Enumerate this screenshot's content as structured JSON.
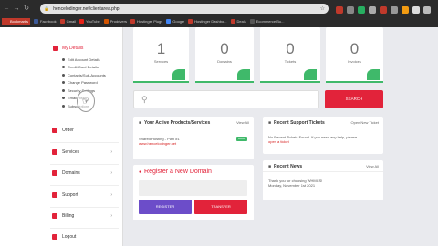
{
  "browser": {
    "url": "hencelodinger.net/clientarea.php",
    "bookmarks": [
      {
        "label": "Bookmarks",
        "color": "#c0392b"
      },
      {
        "label": "Facebook",
        "color": "#3b5998"
      },
      {
        "label": "Gmail",
        "color": "#c0392b"
      },
      {
        "label": "YouTube",
        "color": "#e62117"
      },
      {
        "label": "Prodrivers",
        "color": "#d35400"
      },
      {
        "label": "Hostinger Plugs",
        "color": "#c0392b"
      },
      {
        "label": "Google",
        "color": "#4285f4"
      },
      {
        "label": "Hostinger Dashbo...",
        "color": "#c0392b"
      },
      {
        "label": "Deals",
        "color": "#c0392b"
      },
      {
        "label": "Ecommerce Bu...",
        "color": "#555"
      }
    ]
  },
  "sidebar": {
    "header": "My Details",
    "sub_items": [
      "Edit Account Details",
      "Credit Card Details",
      "Contacts/Sub-Accounts",
      "Change Password",
      "Security Settings",
      "Email History",
      "Subscriptions"
    ],
    "nav": [
      {
        "label": "Order",
        "chevron": false
      },
      {
        "label": "Services",
        "chevron": true
      },
      {
        "label": "Domains",
        "chevron": true
      },
      {
        "label": "Support",
        "chevron": true
      },
      {
        "label": "Billing",
        "chevron": true
      },
      {
        "label": "Logout",
        "chevron": false
      }
    ]
  },
  "stats": [
    {
      "value": "1",
      "label": "Services"
    },
    {
      "value": "0",
      "label": "Domains"
    },
    {
      "value": "0",
      "label": "Tickets"
    },
    {
      "value": "0",
      "label": "Invoices"
    }
  ],
  "search": {
    "placeholder": "",
    "button": "SEARCH"
  },
  "products": {
    "title": "Your Active Products/Services",
    "link": "View All",
    "item_name": "Shared Hosting - Plan #1",
    "item_domain": "www.hencelodinger.net",
    "status": "Active"
  },
  "tickets": {
    "title": "Recent Support Tickets",
    "link": "Open New Ticket",
    "text": "No Recent Tickets Found. If you need any help, please",
    "link_text": "open a ticket"
  },
  "register": {
    "title": "Register a New Domain",
    "btn_register": "REGISTER",
    "btn_transfer": "TRANSFER"
  },
  "news": {
    "title": "Recent News",
    "link": "View All",
    "line1": "Thank you for choosing WHMCS!",
    "line2": "Monday, November 1st 2021"
  },
  "colors": {
    "accent": "#e2233a",
    "green": "#3fb96a",
    "purple": "#6c4dc9"
  }
}
